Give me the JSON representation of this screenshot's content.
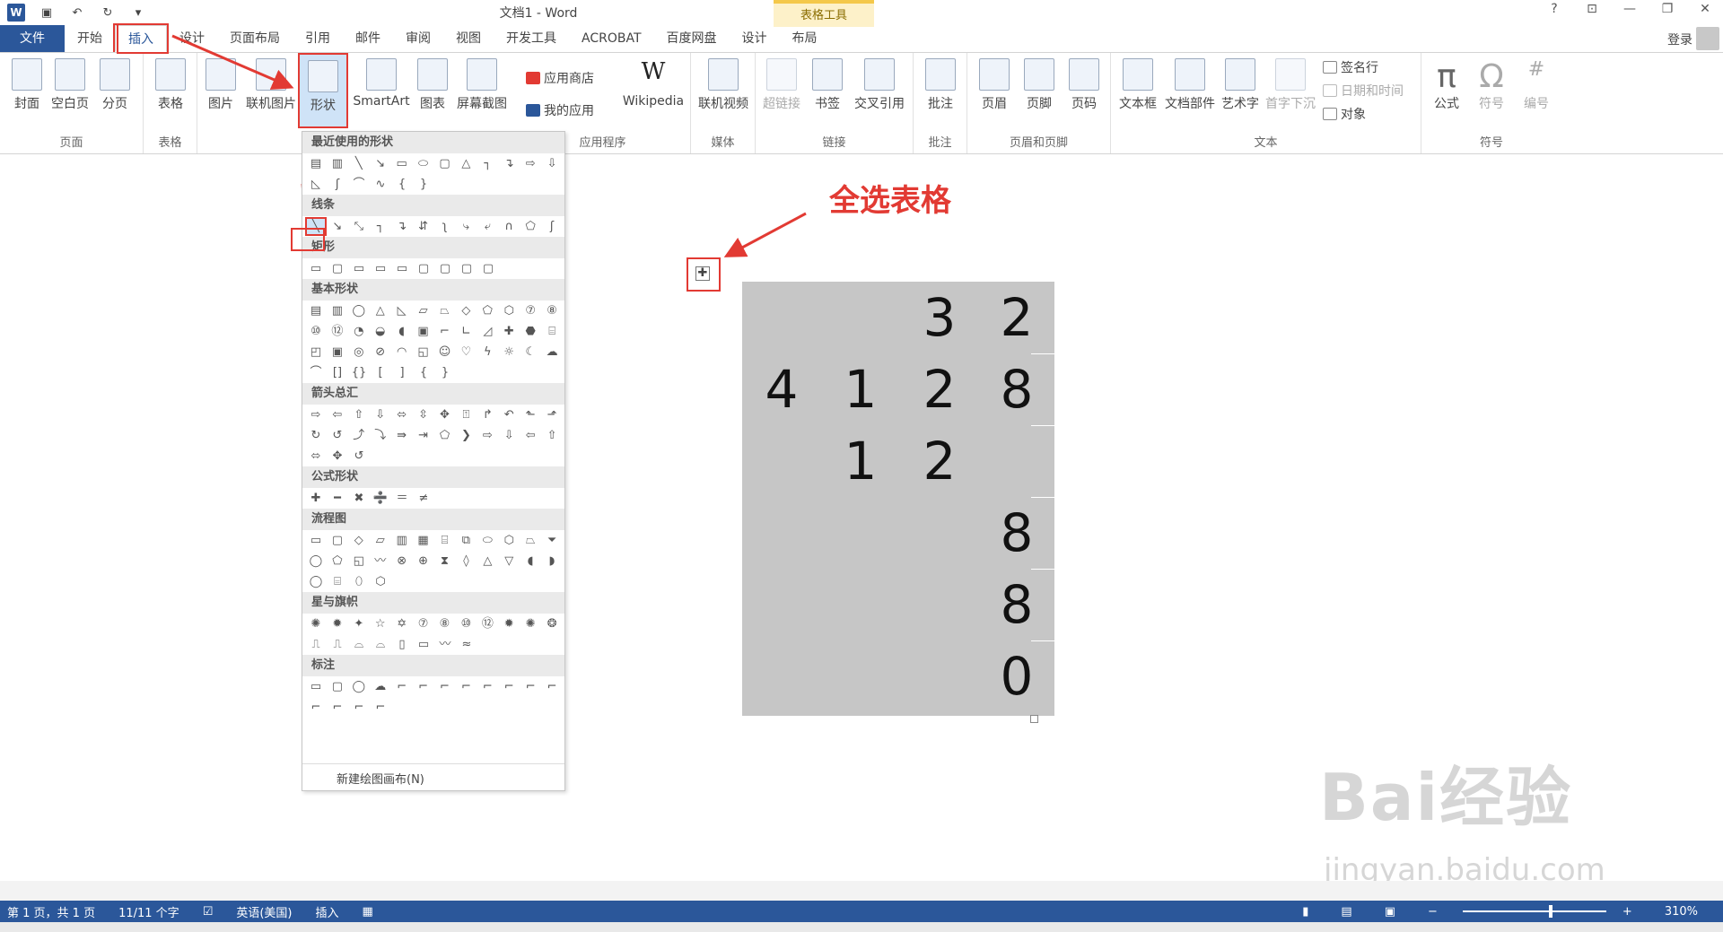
{
  "title_bar": {
    "doc_title": "文档1 - Word",
    "context_tab_group": "表格工具",
    "help": "?",
    "restore_ribbon": "⊡",
    "minimize": "—",
    "restore": "❐",
    "close": "✕"
  },
  "tabs": [
    "文件",
    "开始",
    "插入",
    "设计",
    "页面布局",
    "引用",
    "邮件",
    "审阅",
    "视图",
    "开发工具",
    "ACROBAT",
    "百度网盘",
    "设计",
    "布局"
  ],
  "login": "登录",
  "ribbon": {
    "page_group": {
      "label": "页面",
      "buttons": [
        "封面",
        "空白页",
        "分页"
      ]
    },
    "table_group": {
      "label": "表格",
      "buttons": [
        "表格"
      ]
    },
    "illus_group": {
      "buttons": [
        "图片",
        "联机图片",
        "形状",
        "SmartArt",
        "图表",
        "屏幕截图"
      ]
    },
    "apps_group": {
      "label": "应用程序",
      "store": "应用商店",
      "my_apps": "我的应用",
      "wikipedia": "Wikipedia",
      "w_glyph": "W"
    },
    "media_group": {
      "label": "媒体",
      "buttons": [
        "联机视频"
      ]
    },
    "links_group": {
      "label": "链接",
      "buttons": [
        "超链接",
        "书签",
        "交叉引用"
      ]
    },
    "comment_group": {
      "label": "批注",
      "buttons": [
        "批注"
      ]
    },
    "hf_group": {
      "label": "页眉和页脚",
      "buttons": [
        "页眉",
        "页脚",
        "页码"
      ]
    },
    "text_group": {
      "label": "文本",
      "buttons": [
        "文本框",
        "文档部件",
        "艺术字",
        "首字下沉"
      ],
      "small": [
        "签名行",
        "日期和时间",
        "对象"
      ]
    },
    "symbol_group": {
      "label": "符号",
      "buttons": [
        "公式",
        "符号",
        "编号"
      ],
      "glyphs": [
        "π",
        "Ω",
        "#"
      ]
    }
  },
  "gallery": {
    "categories": [
      "最近使用的形状",
      "线条",
      "矩形",
      "基本形状",
      "箭头总汇",
      "公式形状",
      "流程图",
      "星与旗帜",
      "标注"
    ],
    "new_canvas": "新建绘图画布(N)"
  },
  "annotation": {
    "callout": "全选表格"
  },
  "table": {
    "rows": [
      [
        "",
        "",
        "3",
        "2"
      ],
      [
        "4",
        "1",
        "2",
        "8"
      ],
      [
        "",
        "1",
        "2",
        ""
      ],
      [
        "",
        "",
        "",
        "8"
      ],
      [
        "",
        "",
        "",
        "8"
      ],
      [
        "",
        "",
        "",
        "0"
      ]
    ]
  },
  "watermark": {
    "brand": "Bai经验",
    "url": "jingyan.baidu.com"
  },
  "status_bar": {
    "page": "第 1 页，共 1 页",
    "words": "11/11 个字",
    "language": "英语(美国)",
    "mode": "插入",
    "zoom": "310%"
  }
}
